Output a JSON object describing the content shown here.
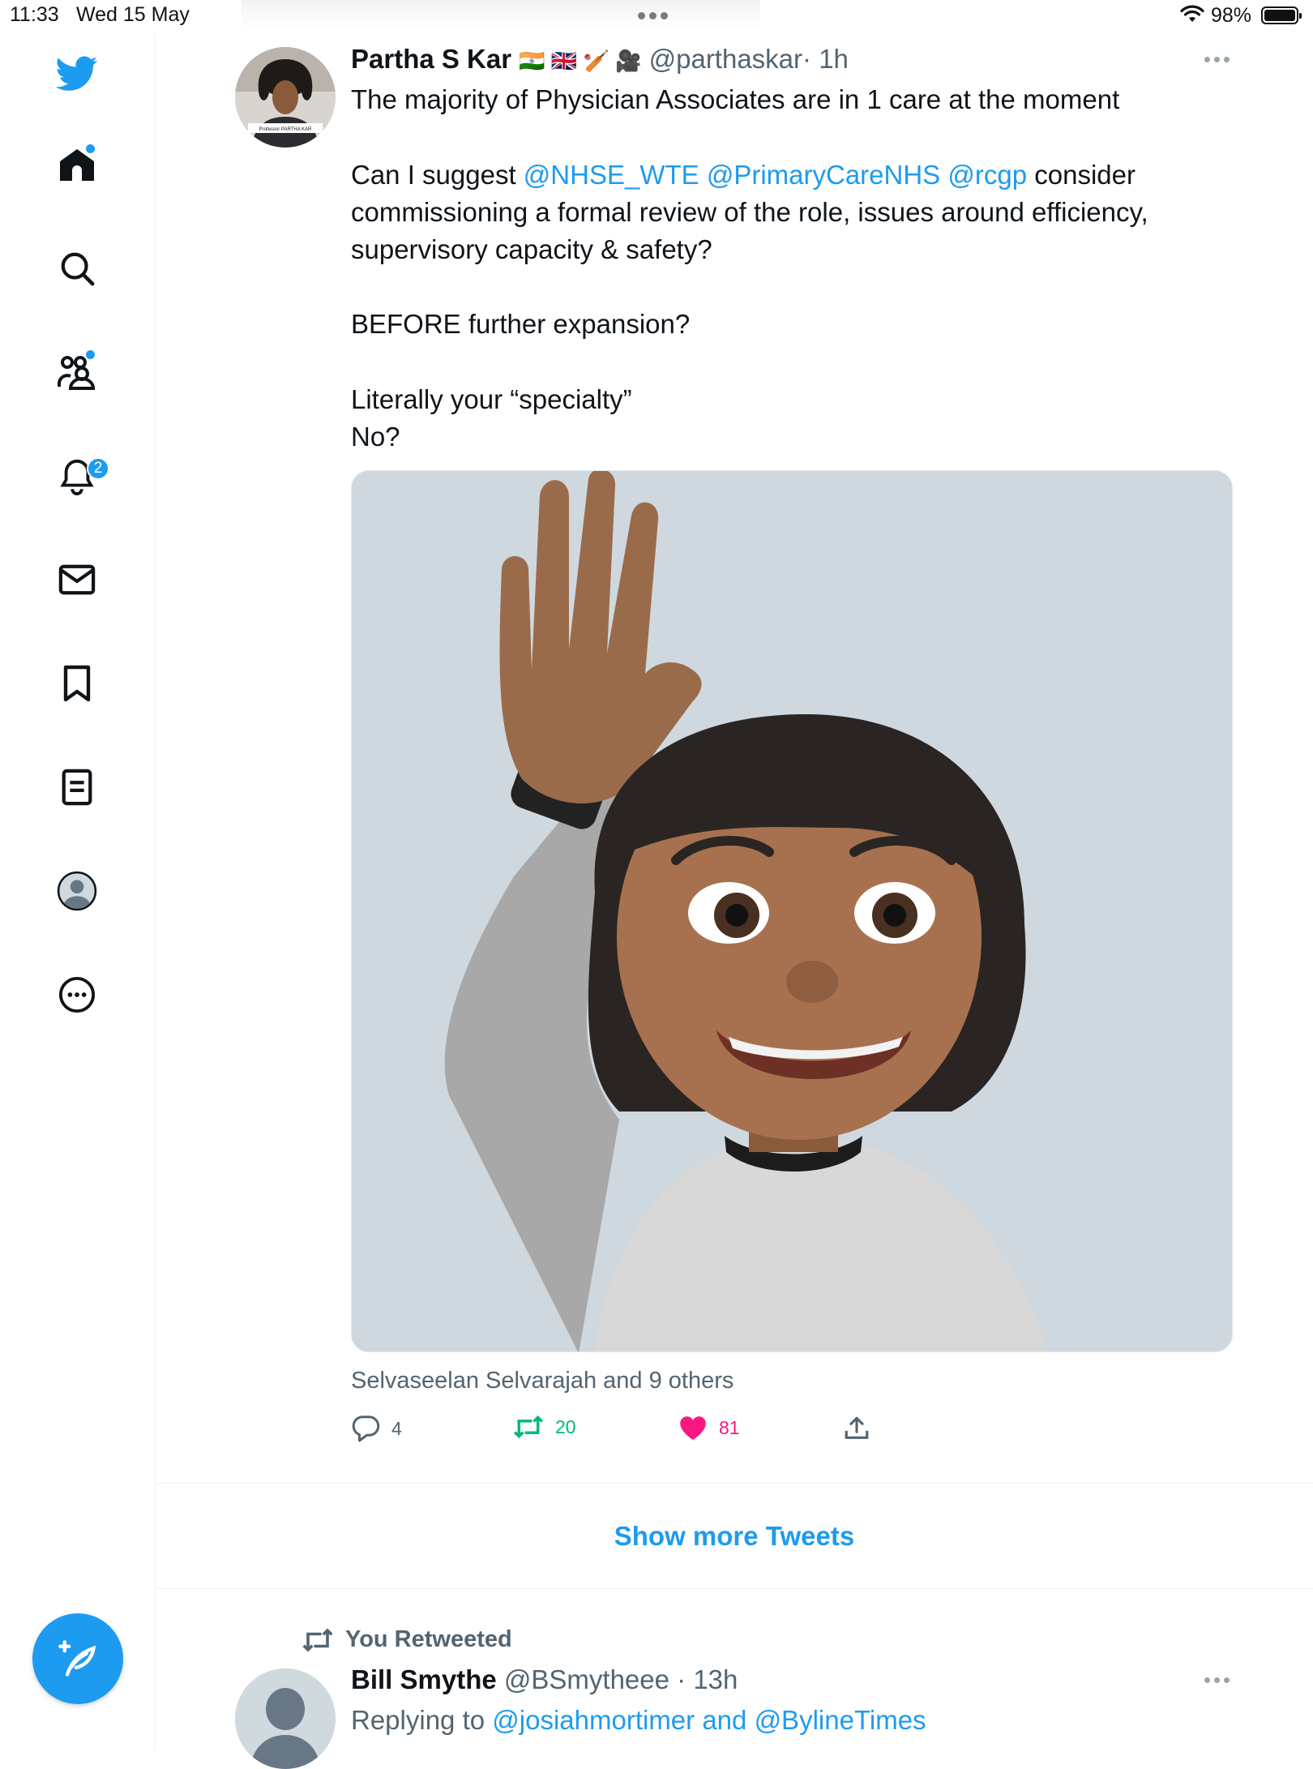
{
  "status_bar": {
    "time": "11:33",
    "date": "Wed 15 May",
    "battery": "98%"
  },
  "sidebar": {
    "items": [
      {
        "name": "twitter-logo"
      },
      {
        "name": "home"
      },
      {
        "name": "search"
      },
      {
        "name": "communities"
      },
      {
        "name": "notifications",
        "badge": "2"
      },
      {
        "name": "messages"
      },
      {
        "name": "bookmarks"
      },
      {
        "name": "lists"
      },
      {
        "name": "profile"
      },
      {
        "name": "more"
      }
    ],
    "compose": "compose-tweet"
  },
  "tweet": {
    "author_name": "Partha S Kar",
    "author_emojis": "🇮🇳 🇬🇧 🏏 🎥",
    "handle": "@parthaskar",
    "time": "· 1h",
    "line1": "The majority of Physician Associates are in 1 care at the moment",
    "line2_pre": "Can I suggest ",
    "mention1": "@NHSE_WTE",
    "mention2": "@PrimaryCareNHS",
    "mention3": "@rcgp",
    "line2_post": " consider",
    "line3": "commissioning  a formal review of the role, issues around efficiency,",
    "line4": "supervisory capacity & safety?",
    "line5": "BEFORE further expansion?",
    "line6": "Literally your “specialty”",
    "line7": "No?",
    "liked_by": "Selvaseelan Selvarajah and 9 others",
    "replies": "4",
    "retweets": "20",
    "likes": "81"
  },
  "show_more_label": "Show more Tweets",
  "tweet2": {
    "retweet_label": "You Retweeted",
    "author_name": "Bill Smythe",
    "handle": "@BSmytheee",
    "time": "· 13h",
    "reply_prefix": "Replying to ",
    "reply_mention1": "@josiahmortimer",
    "reply_and": " and ",
    "reply_mention2": "@BylineTimes"
  },
  "colors": {
    "accent": "#1d9bf0",
    "like": "#f91880",
    "retweet": "#00ba7c",
    "secondary_text": "#536471"
  }
}
